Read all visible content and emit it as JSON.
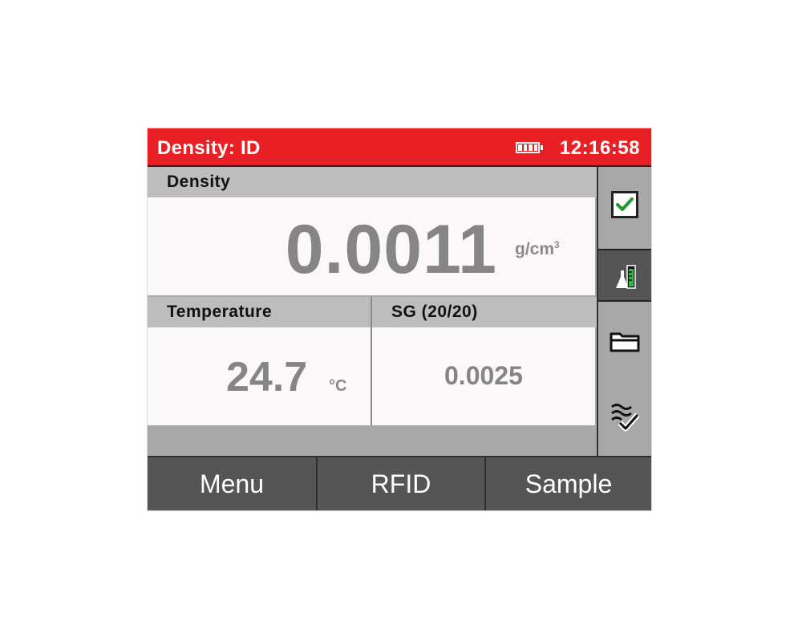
{
  "status_bar": {
    "title": "Density: ID",
    "battery_icon": "battery-full-icon",
    "time": "12:16:58",
    "accent_color": "#e81f25"
  },
  "density": {
    "label": "Density",
    "value": "0.0011",
    "unit": "g/cm",
    "unit_superscript": "3"
  },
  "temperature": {
    "label": "Temperature",
    "value": "24.7",
    "unit": "°C"
  },
  "sg": {
    "label": "SG  (20/20)",
    "value": "0.0025"
  },
  "sidebar": {
    "items": [
      {
        "icon": "checkbox-checked-icon",
        "active": false
      },
      {
        "icon": "measurement-vial-icon",
        "active": true
      },
      {
        "icon": "folder-icon",
        "active": false
      },
      {
        "icon": "list-check-icon",
        "active": false
      }
    ]
  },
  "softkeys": {
    "menu_label": "Menu",
    "rfid_label": "RFID",
    "sample_label": "Sample"
  }
}
